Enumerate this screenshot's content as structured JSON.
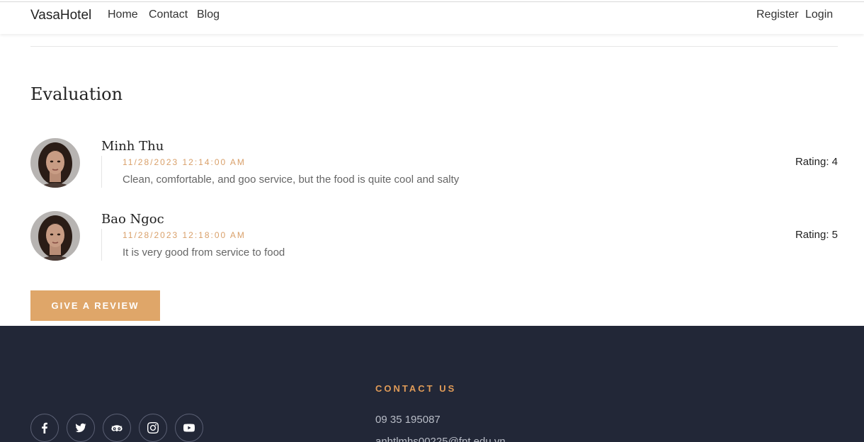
{
  "nav": {
    "brand": "VasaHotel",
    "links": [
      "Home",
      "Contact",
      "Blog"
    ],
    "register": "Register",
    "login": "Login"
  },
  "section_title": "Evaluation",
  "reviews": [
    {
      "name": "Minh Thu",
      "date": "11/28/2023 12:14:00 AM",
      "text": "Clean, comfortable, and goo service, but the food is quite cool and salty",
      "rating": "Rating: 4"
    },
    {
      "name": "Bao Ngoc",
      "date": "11/28/2023 12:18:00 AM",
      "text": "It is very good from service to food",
      "rating": "Rating: 5"
    }
  ],
  "review_button": "GIVE A REVIEW",
  "footer": {
    "contact_heading": "CONTACT US",
    "phone": "09 35 195087",
    "email": "anhtlmhs00225@fpt.edu.vn",
    "socials": [
      "facebook-icon",
      "twitter-icon",
      "tripadvisor-icon",
      "instagram-icon",
      "youtube-icon"
    ]
  },
  "colors": {
    "accent": "#dfa669",
    "date": "#d9a06a",
    "footer_bg": "#222737",
    "contact_heading": "#e09b58"
  }
}
